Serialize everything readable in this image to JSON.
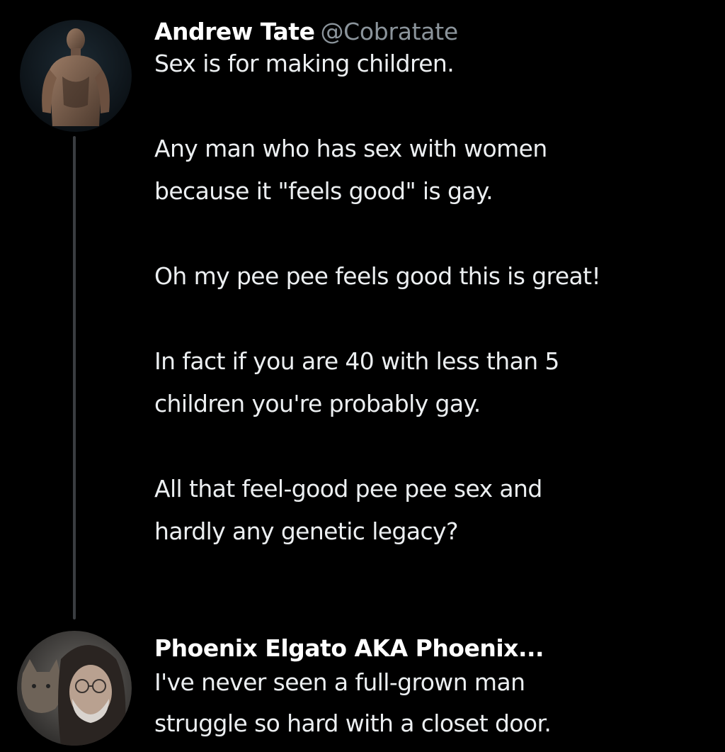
{
  "thread": {
    "tweets": [
      {
        "author": {
          "display_name": "Andrew Tate",
          "handle": "@Cobratate"
        },
        "paragraphs": [
          "Sex is for making children.",
          "Any man who has sex with women\nbecause it \"feels good\" is gay.",
          "Oh my pee pee feels good this is great!",
          "In fact if you are 40 with less than 5\nchildren you're probably gay.",
          "All that feel-good pee pee sex and\nhardly any genetic legacy?"
        ]
      },
      {
        "author": {
          "display_name": "Phoenix Elgato AKA Phoenix..."
        },
        "paragraphs": [
          "I've never seen a full-grown man\nstruggle so hard with a closet door."
        ]
      }
    ]
  },
  "colors": {
    "background": "#000000",
    "name": "#ffffff",
    "handle": "#8b949b",
    "text": "#eceff1",
    "thread_line": "#3a3d41"
  },
  "icons": {
    "avatar_1": "avatar-photo-shirtless-man",
    "avatar_2": "avatar-photo-person-with-cat"
  }
}
